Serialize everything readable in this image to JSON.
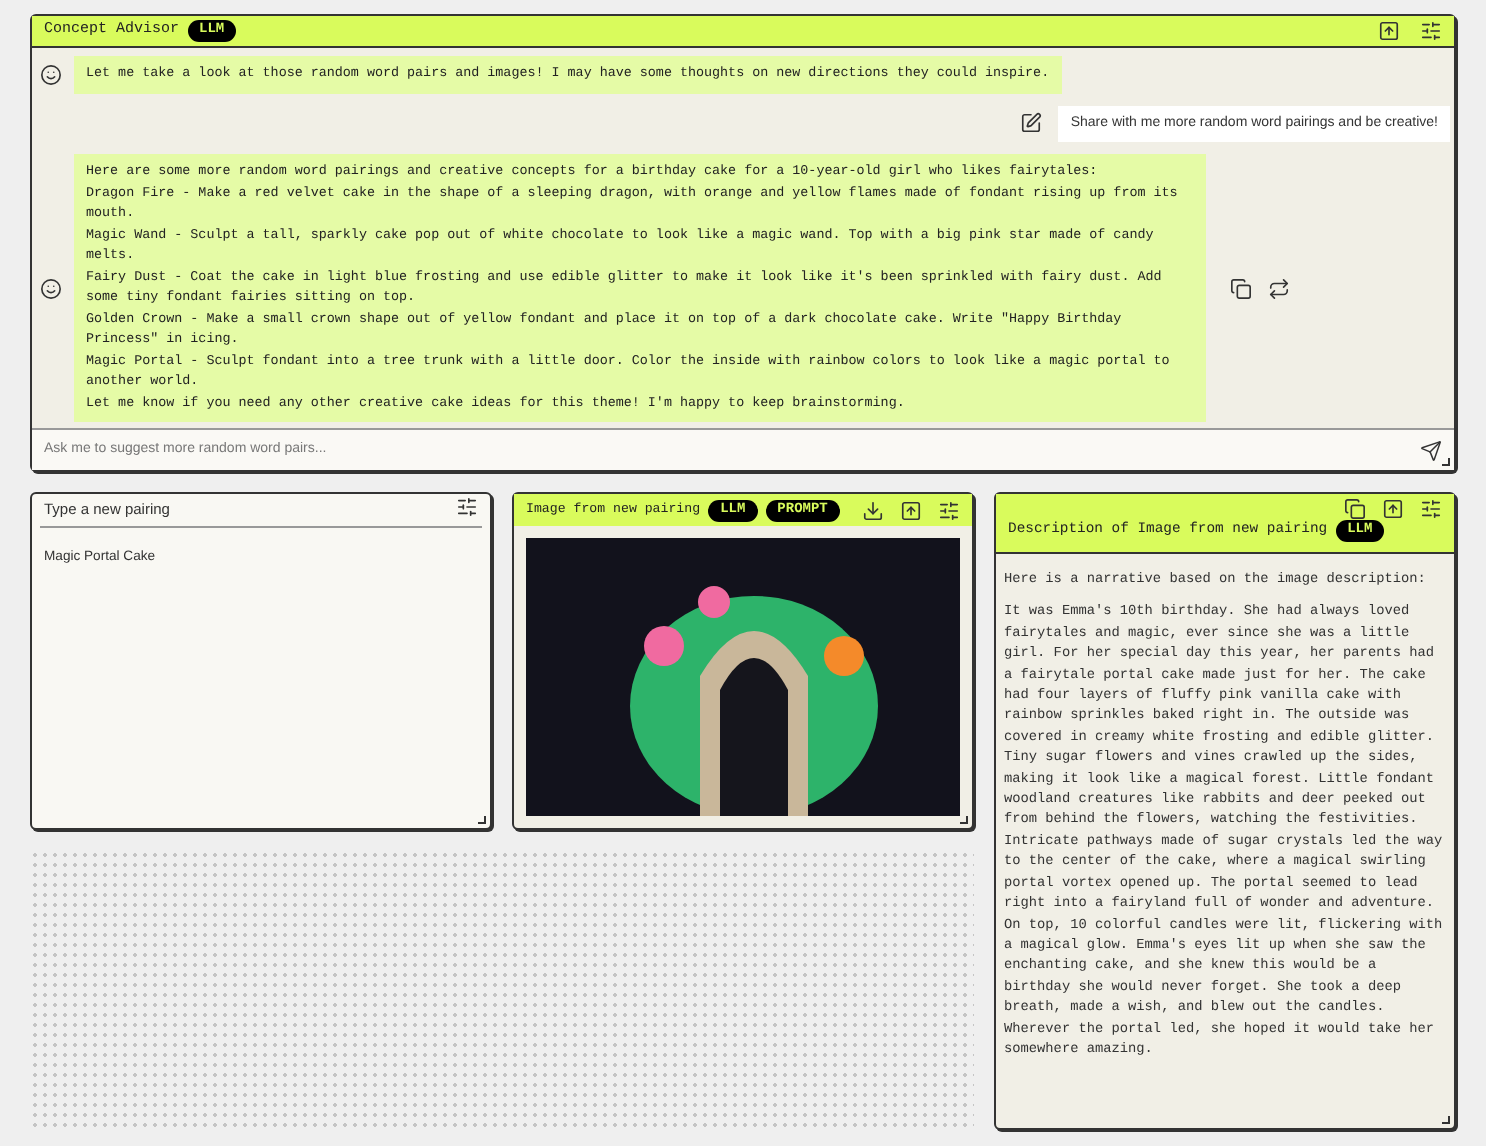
{
  "concept_advisor": {
    "title": "Concept Advisor",
    "badge": "LLM",
    "messages": [
      {
        "kind": "assistant",
        "paragraphs": [
          "Let me take a look at those random word pairs and images! I may have some thoughts on new directions they could inspire."
        ]
      },
      {
        "kind": "user",
        "paragraphs": [
          "Share with me more random word pairings and be creative!"
        ]
      },
      {
        "kind": "assistant",
        "paragraphs": [
          "Here are some more random word pairings and creative concepts for a birthday cake for a 10-year-old girl who likes fairytales:",
          "Dragon Fire - Make a red velvet cake in the shape of a sleeping dragon, with orange and yellow flames made of fondant rising up from its mouth.",
          "Magic Wand - Sculpt a tall, sparkly cake pop out of white chocolate to look like a magic wand. Top with a big pink star made of candy melts.",
          "Fairy Dust - Coat the cake in light blue frosting and use edible glitter to make it look like it's been sprinkled with fairy dust. Add some tiny fondant fairies sitting on top.",
          "Golden Crown - Make a small crown shape out of yellow fondant and place it on top of a dark chocolate cake. Write \"Happy Birthday Princess\" in icing.",
          "Magic Portal - Sculpt fondant into a tree trunk with a little door. Color the inside with rainbow colors to look like a magic portal to another world.",
          "Let me know if you need any other creative cake ideas for this theme! I'm happy to keep brainstorming."
        ]
      }
    ],
    "input": {
      "placeholder": "Ask me to suggest more random word pairs..."
    }
  },
  "pairing_panel": {
    "title": "Type a new pairing",
    "value": "Magic Portal Cake"
  },
  "image_panel": {
    "title": "Image from new pairing",
    "badges": [
      "LLM",
      "PROMPT"
    ]
  },
  "description_panel": {
    "title": "Description of Image from new pairing",
    "badge": "LLM",
    "paragraphs": [
      "Here is a narrative based on the image description:",
      "It was Emma's 10th birthday. She had always loved fairytales and magic, ever since she was a little girl. For her special day this year, her parents had a fairytale portal cake made just for her. The cake had four layers of fluffy pink vanilla cake with rainbow sprinkles baked right in. The outside was covered in creamy white frosting and edible glitter. Tiny sugar flowers and vines crawled up the sides, making it look like a magical forest. Little fondant woodland creatures like rabbits and deer peeked out from behind the flowers, watching the festivities. Intricate pathways made of sugar crystals led the way to the center of the cake, where a magical swirling portal vortex opened up. The portal seemed to lead right into a fairyland full of wonder and adventure. On top, 10 colorful candles were lit, flickering with a magical glow. Emma's eyes lit up when she saw the enchanting cake, and she knew this would be a birthday she would never forget. She took a deep breath, made a wish, and blew out the candles. Wherever the portal led, she hoped it would take her somewhere amazing."
    ]
  }
}
